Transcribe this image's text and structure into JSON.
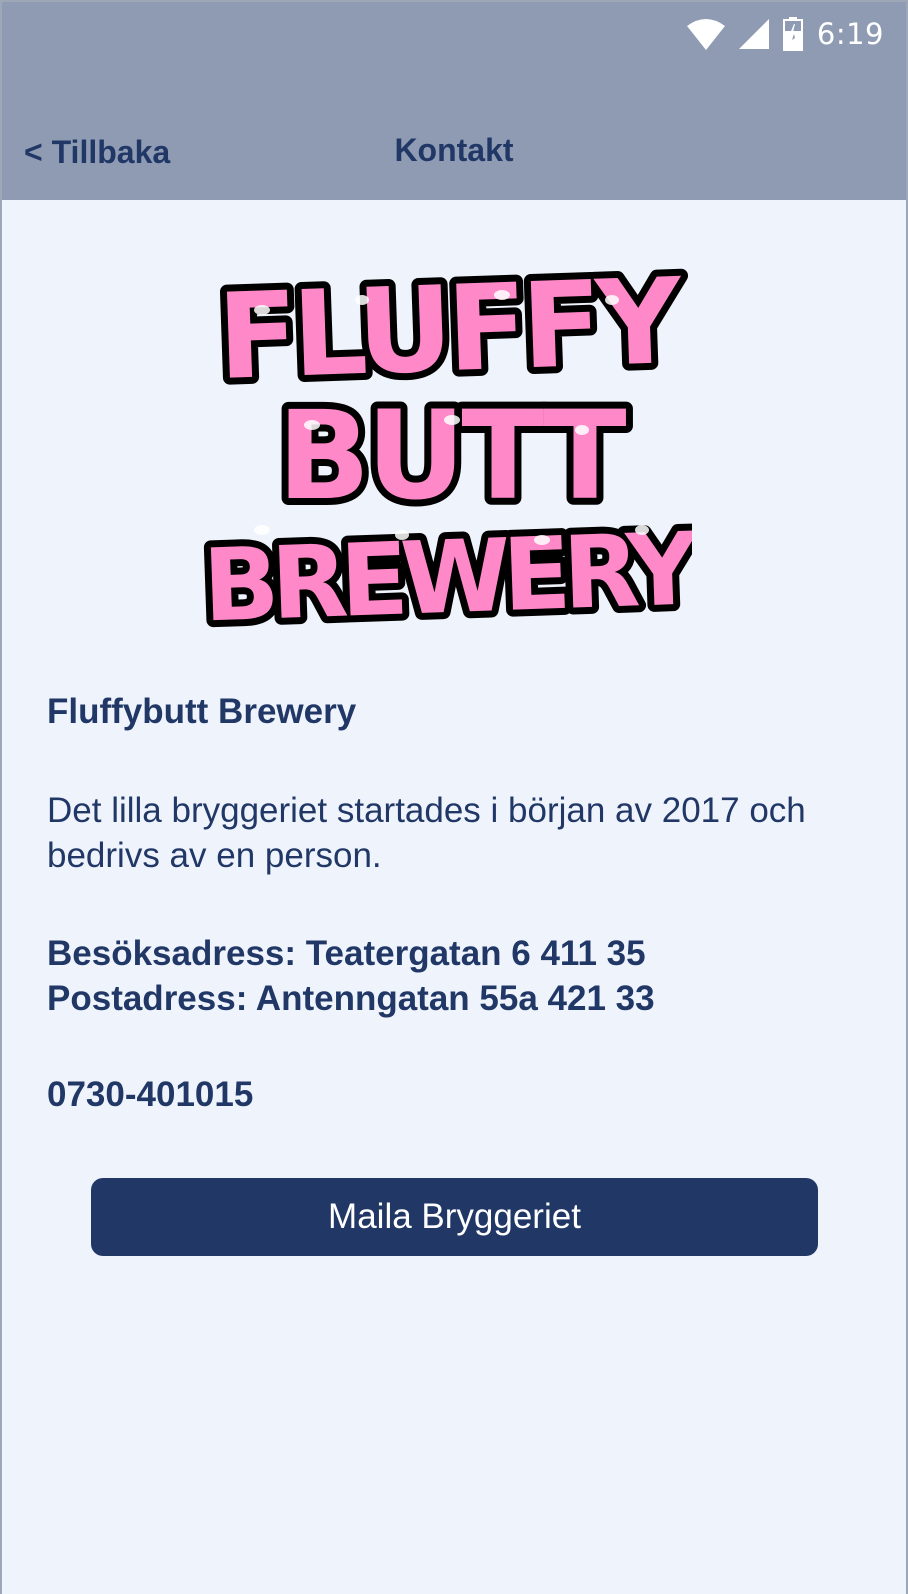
{
  "status_bar": {
    "time": "6:19",
    "icons": [
      "wifi-icon",
      "cellular-signal-icon",
      "battery-charging-icon"
    ]
  },
  "header": {
    "back_label": "< Tillbaka",
    "title": "Kontakt"
  },
  "logo": {
    "lines": [
      "FLUFFY",
      "BUTT",
      "BREWERY"
    ],
    "colors": {
      "fill": "#ff88c8",
      "outline": "#000000",
      "highlight": "#ffffff"
    }
  },
  "main": {
    "brand_name": "Fluffybutt Brewery",
    "description": "Det lilla bryggeriet startades i början av 2017 och bedrivs av en person.",
    "visit_address": "Besöksadress: Teatergatan 6 411 35",
    "postal_address": "Postadress: Antenngatan 55a 421 33",
    "phone": "0730-401015",
    "mail_button_label": "Maila Bryggeriet"
  },
  "colors": {
    "appbar": "#8e9bb3",
    "primary_text": "#213867",
    "button": "#213867",
    "background": "#eff3fc"
  }
}
